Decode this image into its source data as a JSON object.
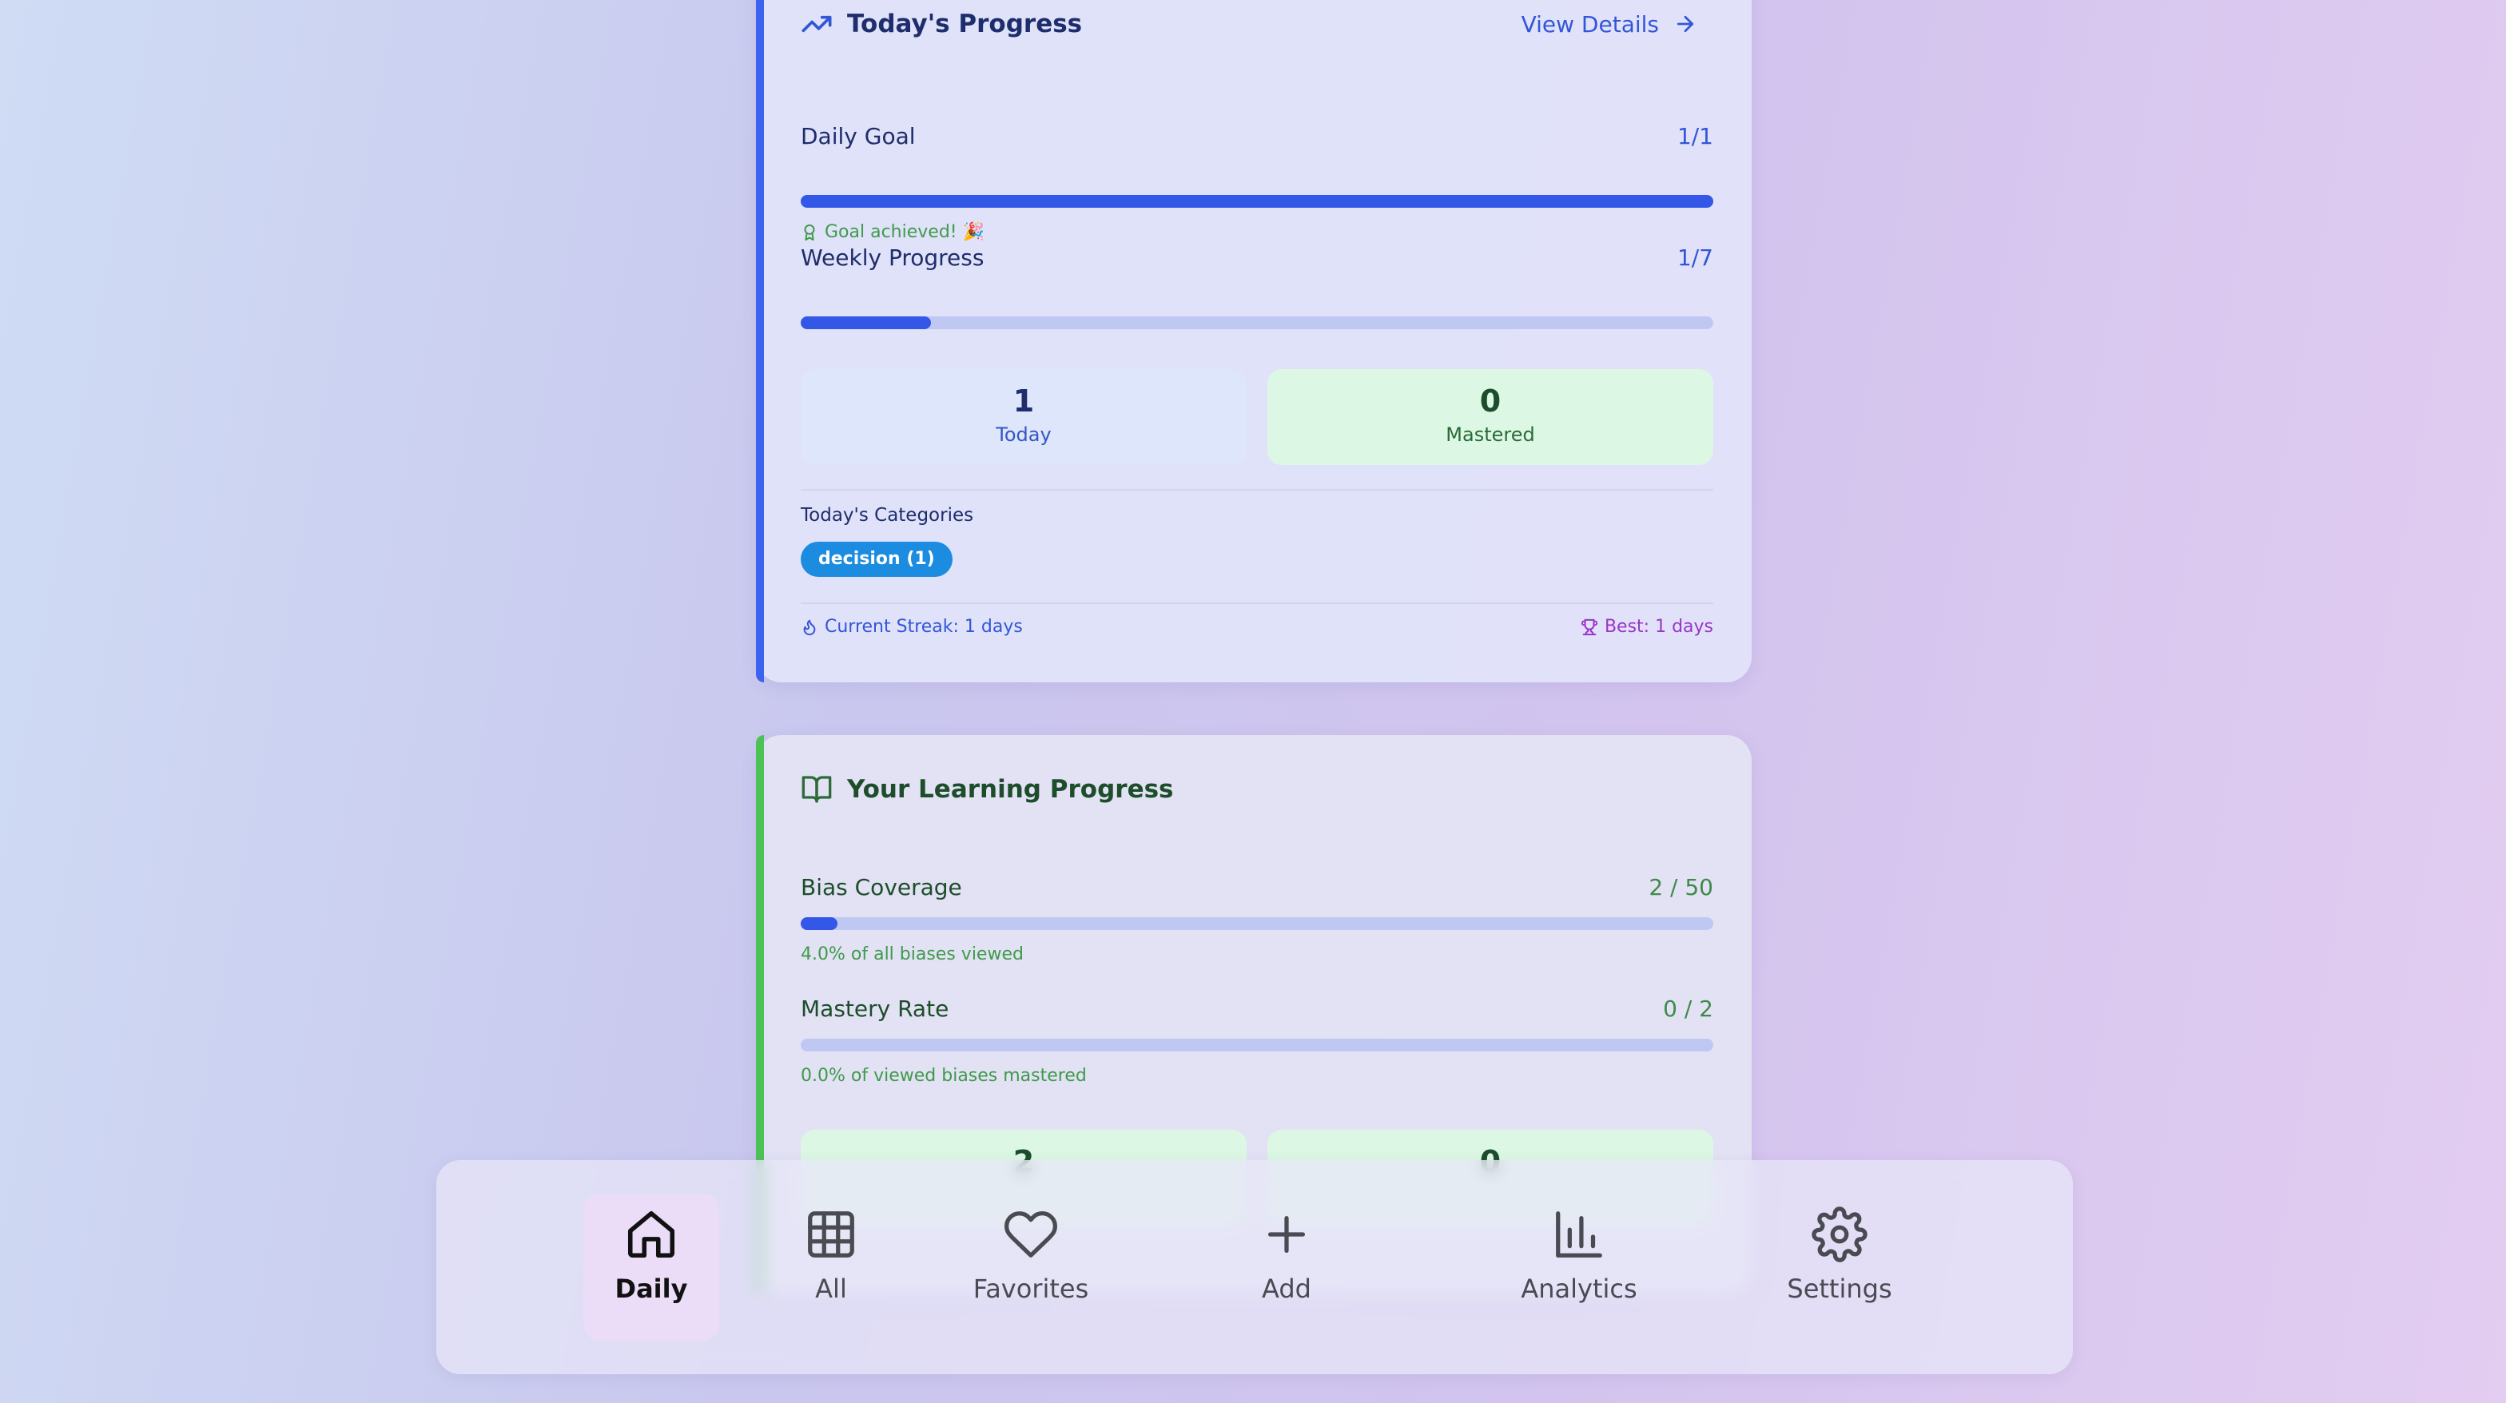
{
  "today": {
    "title": "Today's Progress",
    "view_details": "View Details",
    "daily_goal": {
      "label": "Daily Goal",
      "value": "1/1",
      "fill": 1.0
    },
    "goal_note": "Goal achieved! 🎉",
    "weekly": {
      "label": "Weekly Progress",
      "value": "1/7",
      "fill": 0.143
    },
    "stats": [
      {
        "num": "1",
        "label": "Today"
      },
      {
        "num": "0",
        "label": "Mastered"
      }
    ],
    "categories_heading": "Today's Categories",
    "category_pill": "decision (1)",
    "streak": "Current Streak: 1 days",
    "best": "Best: 1 days"
  },
  "learning": {
    "title": "Your Learning Progress",
    "coverage": {
      "label": "Bias Coverage",
      "value": "2 / 50",
      "fill": 0.04,
      "note": "4.0% of all biases viewed"
    },
    "mastery": {
      "label": "Mastery Rate",
      "value": "0 / 2",
      "fill": 0.0,
      "note": "0.0% of viewed biases mastered"
    },
    "stats": [
      {
        "num": "2"
      },
      {
        "num": "0"
      }
    ]
  },
  "nav": {
    "items": [
      {
        "label": "Daily",
        "icon": "home-icon",
        "active": true
      },
      {
        "label": "All",
        "icon": "grid-icon"
      },
      {
        "label": "Favorites",
        "icon": "heart-icon"
      },
      {
        "label": "Add",
        "icon": "plus-icon"
      },
      {
        "label": "Analytics",
        "icon": "bar-chart-icon"
      },
      {
        "label": "Settings",
        "icon": "gear-icon"
      }
    ]
  },
  "colors": {
    "accent_blue": "#3357e6",
    "accent_green": "#4cc255",
    "pill_blue": "#1b8ce0",
    "best_purple": "#9b35c9"
  }
}
